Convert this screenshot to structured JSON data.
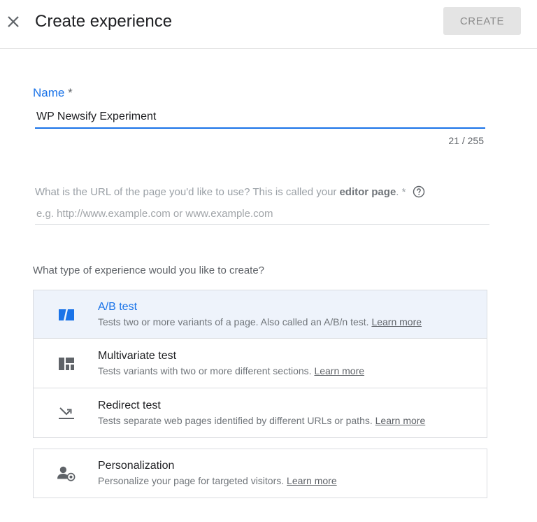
{
  "header": {
    "title": "Create experience",
    "create_label": "CREATE"
  },
  "name_field": {
    "label": "Name",
    "required_mark": "*",
    "value": "WP Newsify Experiment",
    "counter": "21 / 255"
  },
  "url_field": {
    "label_prefix": "What is the URL of the page you'd like to use? This is called your",
    "label_bold": "editor page",
    "label_suffix": ". *",
    "placeholder": "e.g. http://www.example.com or www.example.com"
  },
  "experience_types": {
    "question": "What type of experience would you like to create?",
    "learn_more": "Learn more",
    "options": [
      {
        "title": "A/B test",
        "description": "Tests two or more variants of a page. Also called an A/B/n test.",
        "icon": "ab-test-icon",
        "selected": true
      },
      {
        "title": "Multivariate test",
        "description": "Tests variants with two or more different sections.",
        "icon": "multivariate-icon",
        "selected": false
      },
      {
        "title": "Redirect test",
        "description": "Tests separate web pages identified by different URLs or paths.",
        "icon": "redirect-icon",
        "selected": false
      },
      {
        "title": "Personalization",
        "description": "Personalize your page for targeted visitors.",
        "icon": "personalization-icon",
        "selected": false
      }
    ]
  },
  "colors": {
    "accent": "#1a73e8",
    "selected_bg": "#eef3fb",
    "disabled_button_bg": "#e4e4e4"
  }
}
